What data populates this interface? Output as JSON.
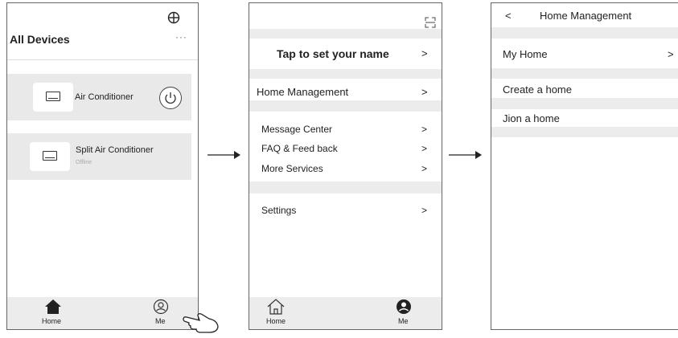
{
  "screen1": {
    "title": "All Devices",
    "add_icon": "plus-circle-icon",
    "more_label": "···",
    "devices": [
      {
        "name": "Air Conditioner",
        "status": "",
        "icon": "air-conditioner-icon",
        "power_icon": "power-icon"
      },
      {
        "name": "Split Air Conditioner",
        "status": "Offline",
        "icon": "air-conditioner-icon"
      }
    ],
    "tabs": [
      {
        "label": "Home",
        "icon": "home-icon"
      },
      {
        "label": "Me",
        "icon": "user-icon"
      }
    ],
    "hand_icon": "pointing-hand-icon"
  },
  "screen2": {
    "scan_icon": "scan-icon",
    "set_name": "Tap to set your name",
    "home_management": "Home Management",
    "menu": [
      "Message Center",
      "FAQ & Feed back",
      "More Services"
    ],
    "settings": "Settings",
    "chevron": ">",
    "tabs": [
      {
        "label": "Home",
        "icon": "home-icon"
      },
      {
        "label": "Me",
        "icon": "user-icon"
      }
    ]
  },
  "screen3": {
    "back": "<",
    "title": "Home Management",
    "my_home": "My Home",
    "chevron": ">",
    "create_home": "Create a home",
    "join_home": "Jion a home"
  },
  "colors": {
    "band": "#ececec",
    "card": "#e9e9e9",
    "border": "#666666"
  }
}
